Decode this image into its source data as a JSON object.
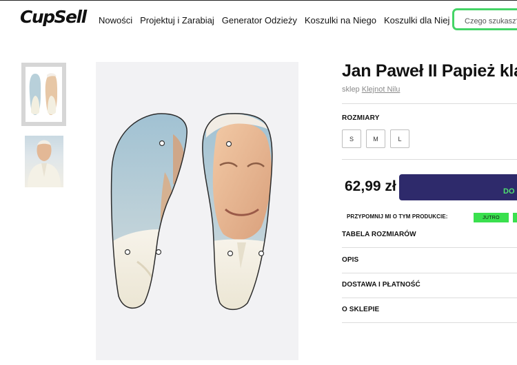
{
  "header": {
    "logo": "CupSell",
    "nav": [
      "Nowości",
      "Projektuj i Zarabiaj",
      "Generator Odzieży",
      "Koszulki na Niego",
      "Koszulki dla Niej"
    ],
    "search_placeholder": "Czego szukasz?"
  },
  "product": {
    "title": "Jan Paweł II Papież klap",
    "shop_prefix": "sklep",
    "shop_name": "Klejnot Nilu",
    "sizes_label": "ROZMIARY",
    "sizes": [
      "S",
      "M",
      "L"
    ],
    "price": "62,99 zł",
    "cart_label": "DO",
    "remind_label": "PRZYPOMNIJ MI O TYM PRODUKCIE:",
    "remind_options": [
      "JUTRO",
      ""
    ],
    "sections": [
      "TABELA ROZMIARÓW",
      "OPIS",
      "DOSTAWA I PŁATNOŚĆ",
      "O SKLEPIE"
    ]
  },
  "colors": {
    "accent_green": "#44d466",
    "button_navy": "#2e2a6b",
    "chip_green": "#3ae04e"
  },
  "icons": [
    "sandal-left-image",
    "sandal-right-image",
    "portrait-thumbnail"
  ]
}
